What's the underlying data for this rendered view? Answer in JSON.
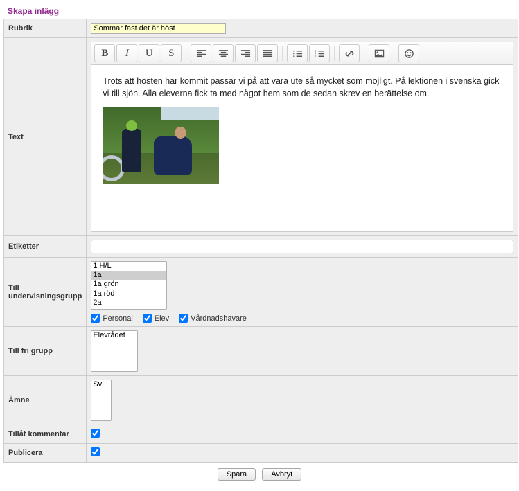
{
  "title": "Skapa inlägg",
  "labels": {
    "rubrik": "Rubrik",
    "text": "Text",
    "etiketter": "Etiketter",
    "till_grupp": "Till undervisningsgrupp",
    "till_fri": "Till fri grupp",
    "amne": "Ämne",
    "tillat": "Tillåt kommentar",
    "publicera": "Publicera"
  },
  "rubrik_value": "Sommar fast det är höst",
  "editor_text": "Trots att hösten har kommit passar vi på att vara ute så mycket som möjligt. På lektionen i svenska gick vi till sjön. Alla eleverna fick ta med något hem som de sedan skrev en berättelse om.",
  "etiketter_value": "",
  "grupp_options": [
    "1 H/L",
    "1a",
    "1a grön",
    "1a röd",
    "2a"
  ],
  "grupp_selected": "1a",
  "checkboxes": {
    "personal": "Personal",
    "elev": "Elev",
    "vard": "Vårdnadshavare"
  },
  "fri_options": [
    "Elevrådet"
  ],
  "amne_options": [
    "Sv"
  ],
  "tillat_checked": true,
  "publicera_checked": true,
  "buttons": {
    "spara": "Spara",
    "avbryt": "Avbryt"
  },
  "toolbar": {
    "bold": "B",
    "italic": "I",
    "underline": "U",
    "strike": "S"
  }
}
